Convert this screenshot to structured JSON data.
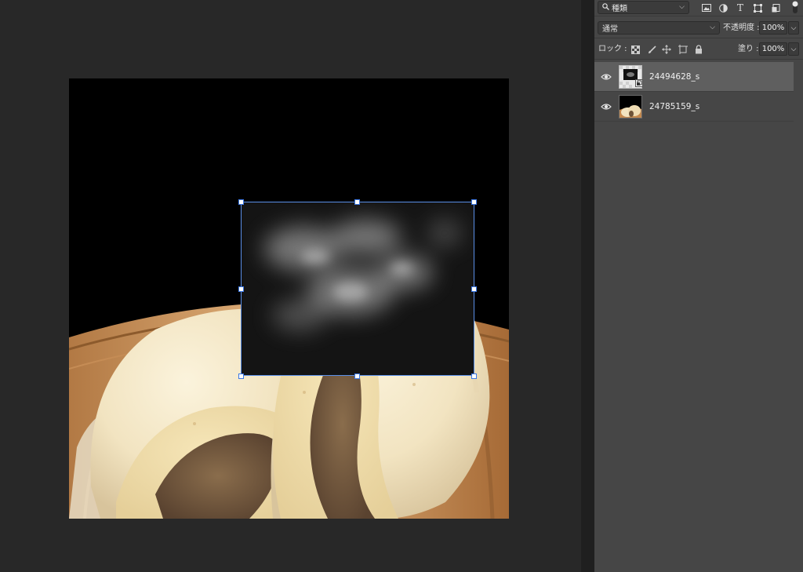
{
  "panel": {
    "filter": {
      "label": "種類",
      "icons": [
        "image-filter-icon",
        "adjustment-filter-icon",
        "type-filter-icon",
        "shape-filter-icon",
        "smart-object-filter-icon"
      ]
    },
    "blend_mode": {
      "value": "通常"
    },
    "opacity": {
      "label": "不透明度 :",
      "value": "100%"
    },
    "lock": {
      "label": "ロック :",
      "icons": [
        "lock-transparent-icon",
        "lock-paint-icon",
        "lock-position-icon",
        "lock-artboard-icon",
        "lock-all-icon"
      ]
    },
    "fill": {
      "label": "塗り :",
      "value": "100%"
    },
    "layers": [
      {
        "name": "24494628_s",
        "selected": true,
        "smart_object": true
      },
      {
        "name": "24785159_s",
        "selected": false,
        "smart_object": false
      }
    ]
  },
  "colors": {
    "accent": "#3c78e6",
    "panel_bg": "#464646",
    "workspace_bg": "#282828"
  }
}
